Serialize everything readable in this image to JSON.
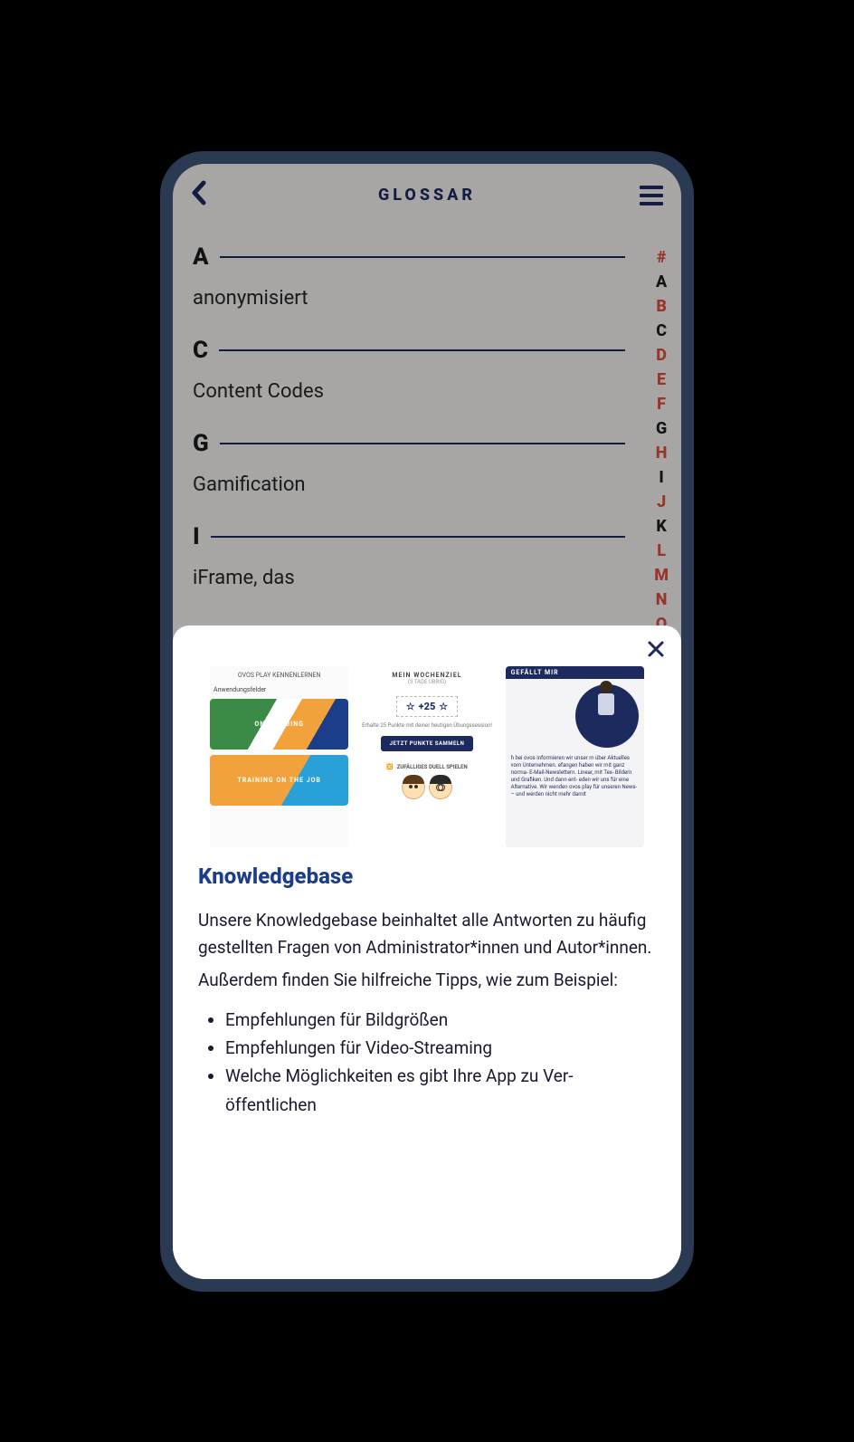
{
  "header": {
    "title": "GLOSSAR"
  },
  "glossary": {
    "sections": [
      {
        "letter": "A",
        "items": [
          "anonymisiert"
        ]
      },
      {
        "letter": "C",
        "items": [
          "Content Codes"
        ]
      },
      {
        "letter": "G",
        "items": [
          "Gamification"
        ]
      },
      {
        "letter": "I",
        "items": [
          "iFrame, das"
        ]
      }
    ]
  },
  "alpha_index": [
    {
      "char": "#",
      "active": false
    },
    {
      "char": "A",
      "active": true
    },
    {
      "char": "B",
      "active": false
    },
    {
      "char": "C",
      "active": true
    },
    {
      "char": "D",
      "active": false
    },
    {
      "char": "E",
      "active": false
    },
    {
      "char": "F",
      "active": false
    },
    {
      "char": "G",
      "active": true
    },
    {
      "char": "H",
      "active": false
    },
    {
      "char": "I",
      "active": true
    },
    {
      "char": "J",
      "active": false
    },
    {
      "char": "K",
      "active": true
    },
    {
      "char": "L",
      "active": false
    },
    {
      "char": "M",
      "active": false
    },
    {
      "char": "N",
      "active": false
    },
    {
      "char": "O",
      "active": false
    }
  ],
  "sheet": {
    "title": "Knowledgebase",
    "p1": "Unsere Knowledgebase beinhaltet alle Antworten zu häufig gestellten Fragen von Administrator*innen und Autor*innen.",
    "p2": "Außerdem finden Sie hilfreiche Tipps, wie zum Beispiel:",
    "bullets": [
      "Empfehlungen für Bildgrößen",
      "Empfehlungen für Video-Streaming",
      "Welche Möglichkeiten es gibt Ihre App zu Ver­öffentlichen"
    ],
    "preview": {
      "col1": {
        "heading": "OVOS PLAY KENNENLERNEN",
        "label": "Anwendungsfelder",
        "card1": "ONBOARDING",
        "card2": "TRAINING ON THE JOB"
      },
      "col2": {
        "h1": "MEIN WOCHENZIEL",
        "h2": "(3 TAGE ÜBRIG)",
        "points": "+25",
        "sub": "Erhalte 25 Punkte mit deiner heutigen Übungssession!",
        "button": "JETZT PUNKTE SAMMELN",
        "shuffle": "ZUFÄLLIGES DUELL SPIELEN"
      },
      "col3": {
        "bar": "GEFÄLLT MIR",
        "text": "h bei ovos informieren wir unser m über Aktuelles vom Unternehmen. efangen haben wir mit ganz norma- E-Mail-Newslettern. Linear, mit Tex- Bildern und Grafiken. Und dann ent- eden wir uns für eine Alternative. Wir wenden ovos play für unseren News- – und werden nicht mehr damit"
      }
    }
  }
}
